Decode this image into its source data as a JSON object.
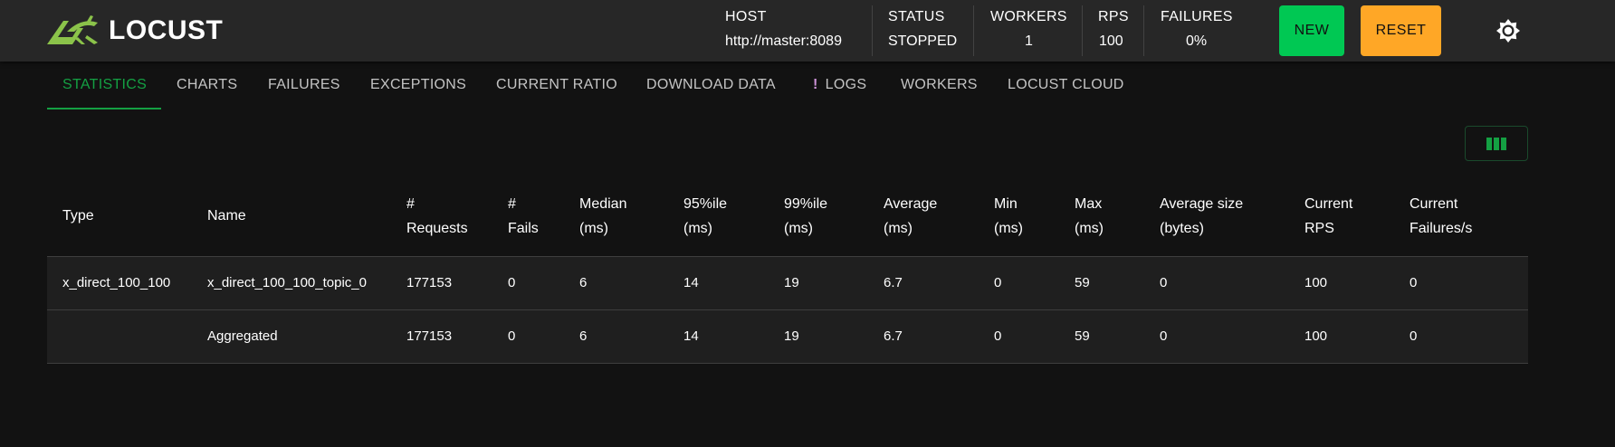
{
  "brand": {
    "name": "LOCUST"
  },
  "header": {
    "host": {
      "label": "HOST",
      "value": "http://master:8089"
    },
    "status": {
      "label": "STATUS",
      "value": "STOPPED"
    },
    "workers": {
      "label": "WORKERS",
      "value": "1"
    },
    "rps": {
      "label": "RPS",
      "value": "100"
    },
    "failures": {
      "label": "FAILURES",
      "value": "0%"
    },
    "new_label": "NEW",
    "reset_label": "RESET",
    "theme_icon": "brightness-icon"
  },
  "tabs": [
    {
      "label": "STATISTICS",
      "active": true
    },
    {
      "label": "CHARTS"
    },
    {
      "label": "FAILURES"
    },
    {
      "label": "EXCEPTIONS"
    },
    {
      "label": "CURRENT RATIO"
    },
    {
      "label": "DOWNLOAD DATA"
    },
    {
      "label": "LOGS",
      "alert": "!"
    },
    {
      "label": "WORKERS"
    },
    {
      "label": "LOCUST CLOUD"
    }
  ],
  "table": {
    "columns": [
      [
        "Type"
      ],
      [
        "Name"
      ],
      [
        "#",
        "Requests"
      ],
      [
        "#",
        "Fails"
      ],
      [
        "Median",
        "(ms)"
      ],
      [
        "95%ile",
        "(ms)"
      ],
      [
        "99%ile",
        "(ms)"
      ],
      [
        "Average",
        "(ms)"
      ],
      [
        "Min",
        "(ms)"
      ],
      [
        "Max",
        "(ms)"
      ],
      [
        "Average size",
        "(bytes)"
      ],
      [
        "Current",
        "RPS"
      ],
      [
        "Current",
        "Failures/s"
      ]
    ],
    "rows": [
      [
        "x_direct_100_100",
        "x_direct_100_100_topic_0",
        "177153",
        "0",
        "6",
        "14",
        "19",
        "6.7",
        "0",
        "59",
        "0",
        "100",
        "0"
      ],
      [
        "",
        "Aggregated",
        "177153",
        "0",
        "6",
        "14",
        "19",
        "6.7",
        "0",
        "59",
        "0",
        "100",
        "0"
      ]
    ]
  },
  "colors": {
    "accent_green": "#14a043",
    "new_button": "#00c853",
    "reset_button": "#ffa726",
    "logs_alert": "#ce93d8",
    "logo_green": "#8bc34a"
  }
}
